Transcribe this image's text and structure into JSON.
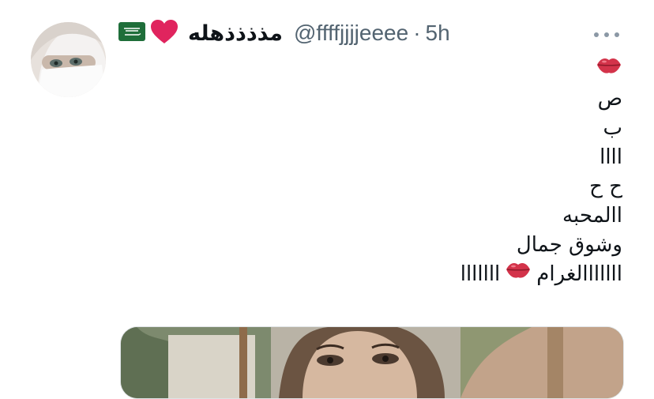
{
  "tweet": {
    "author": {
      "display_name": "مذذذذهله",
      "handle": "@ffffjjjjeeee",
      "separator": "·",
      "time": "5h",
      "badges": [
        "saudi-flag-icon",
        "red-heart-icon"
      ]
    },
    "lines": [
      "ص",
      "ب",
      "اااا",
      "ح ح",
      "االمحبه",
      "وشوق جمال",
      "ااااااا",
      "ااااااالغرام"
    ],
    "icons": {
      "more": "more-icon",
      "emoji": "kiss-mark-icon"
    }
  },
  "colors": {
    "text": "#0f1419",
    "secondary": "#536471",
    "accent_heart": "#e0245e",
    "flag_green": "#1f6e3a",
    "lips_red": "#d3334a"
  }
}
